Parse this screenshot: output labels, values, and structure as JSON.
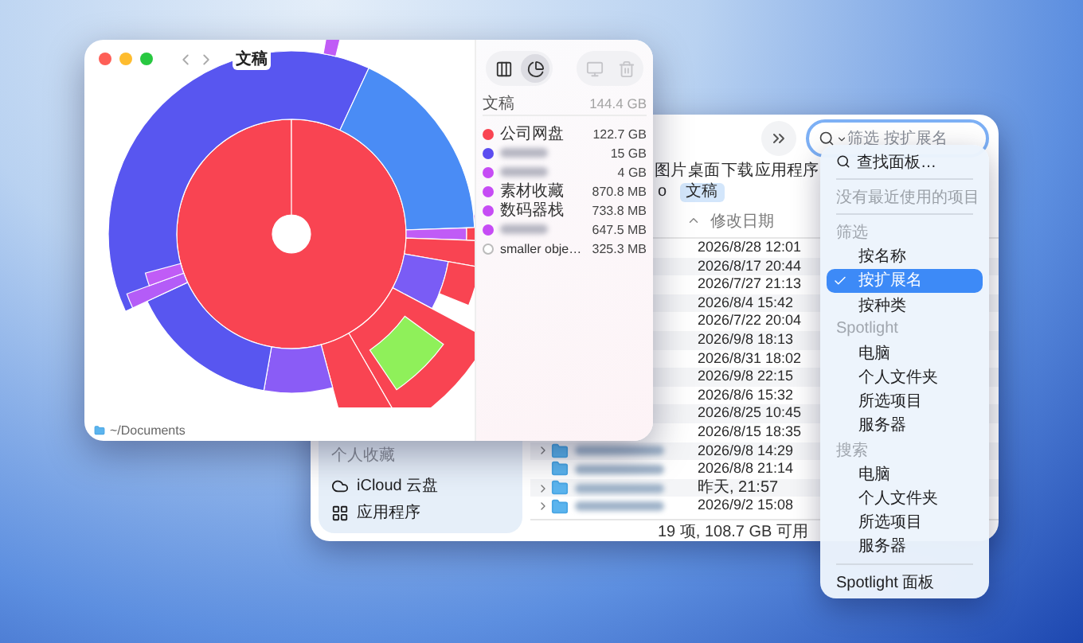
{
  "sunburst_window": {
    "title": "文稿",
    "view_modes": [
      {
        "kind": "columns",
        "selected": false
      },
      {
        "kind": "sunburst",
        "selected": true
      }
    ],
    "summary": {
      "name": "文稿",
      "size": "144.4 GB"
    },
    "legend": [
      {
        "name": "公司网盘",
        "size": "122.7 GB",
        "color": "#f94452",
        "kind": "item"
      },
      {
        "size": "15 GB",
        "color": "#5b4cf0",
        "kind": "blurred"
      },
      {
        "size": "4 GB",
        "color": "#c64cf5",
        "kind": "blurred"
      },
      {
        "name": "素材收藏",
        "size": "870.8 MB",
        "color": "#c64cf5",
        "kind": "item"
      },
      {
        "name": "数码器栈",
        "size": "733.8 MB",
        "color": "#c64cf5",
        "kind": "item"
      },
      {
        "size": "647.5 MB",
        "color": "#c64cf5",
        "kind": "blurred"
      },
      {
        "name": "smaller obje…",
        "size": "325.3 MB",
        "color": "#ffffff",
        "kind": "other"
      }
    ],
    "location": "~/Documents"
  },
  "finder": {
    "search": {
      "placeholder": "筛选 按扩展名"
    },
    "favorites": [
      "图片",
      "桌面",
      "下载",
      "应用程序"
    ],
    "path": [
      {
        "label": "o",
        "selected": false
      },
      {
        "label": "文稿",
        "selected": true
      }
    ],
    "columns": [
      "修改日期"
    ],
    "rows": [
      {
        "date": "2026/8/28 12:01",
        "expandable": false
      },
      {
        "date": "2026/8/17 20:44",
        "expandable": false
      },
      {
        "date": "2026/7/27 21:13",
        "expandable": false
      },
      {
        "date": "2026/8/4 15:42",
        "expandable": false
      },
      {
        "date": "2026/7/22 20:04",
        "expandable": false
      },
      {
        "date": "2026/9/8 18:13",
        "expandable": false
      },
      {
        "date": "2026/8/31 18:02",
        "expandable": false
      },
      {
        "date": "2026/9/8 22:15",
        "expandable": false
      },
      {
        "date": "2026/8/6 15:32",
        "expandable": false
      },
      {
        "date": "2026/8/25 10:45",
        "expandable": false
      },
      {
        "date": "2026/8/15 18:35",
        "expandable": false
      },
      {
        "date": "2026/9/8 14:29",
        "expandable": true,
        "blurred_name": true
      },
      {
        "date": "2026/8/8 21:14",
        "expandable": false,
        "blurred_name": true
      },
      {
        "date": "昨天, 21:57",
        "expandable": true,
        "blurred_name": true
      },
      {
        "date": "2026/9/2 15:08",
        "expandable": true,
        "blurred_name": true
      }
    ],
    "status": "19 项, 108.7 GB 可用",
    "sidebar": {
      "section": "个人收藏",
      "items": [
        {
          "kind": "cloud",
          "label": "iCloud 云盘"
        },
        {
          "kind": "apps",
          "label": "应用程序"
        }
      ]
    }
  },
  "search_menu": {
    "items": [
      {
        "kind": "action",
        "label": "查找面板…"
      },
      {
        "kind": "divider"
      },
      {
        "kind": "note",
        "label": "没有最近使用的项目"
      },
      {
        "kind": "divider"
      },
      {
        "kind": "header",
        "label": "筛选"
      },
      {
        "kind": "option",
        "label": "按名称",
        "selected": false
      },
      {
        "kind": "option",
        "label": "按扩展名",
        "selected": true
      },
      {
        "kind": "option",
        "label": "按种类",
        "selected": false
      },
      {
        "kind": "header",
        "label": "Spotlight"
      },
      {
        "kind": "option",
        "label": "电脑",
        "selected": false
      },
      {
        "kind": "option",
        "label": "个人文件夹",
        "selected": false
      },
      {
        "kind": "option",
        "label": "所选项目",
        "selected": false
      },
      {
        "kind": "option",
        "label": "服务器",
        "selected": false
      },
      {
        "kind": "header",
        "label": "搜索"
      },
      {
        "kind": "option",
        "label": "电脑",
        "selected": false
      },
      {
        "kind": "option",
        "label": "个人文件夹",
        "selected": false
      },
      {
        "kind": "option",
        "label": "所选项目",
        "selected": false
      },
      {
        "kind": "option",
        "label": "服务器",
        "selected": false
      },
      {
        "kind": "divider"
      },
      {
        "kind": "action",
        "label": "Spotlight 面板"
      }
    ]
  }
}
